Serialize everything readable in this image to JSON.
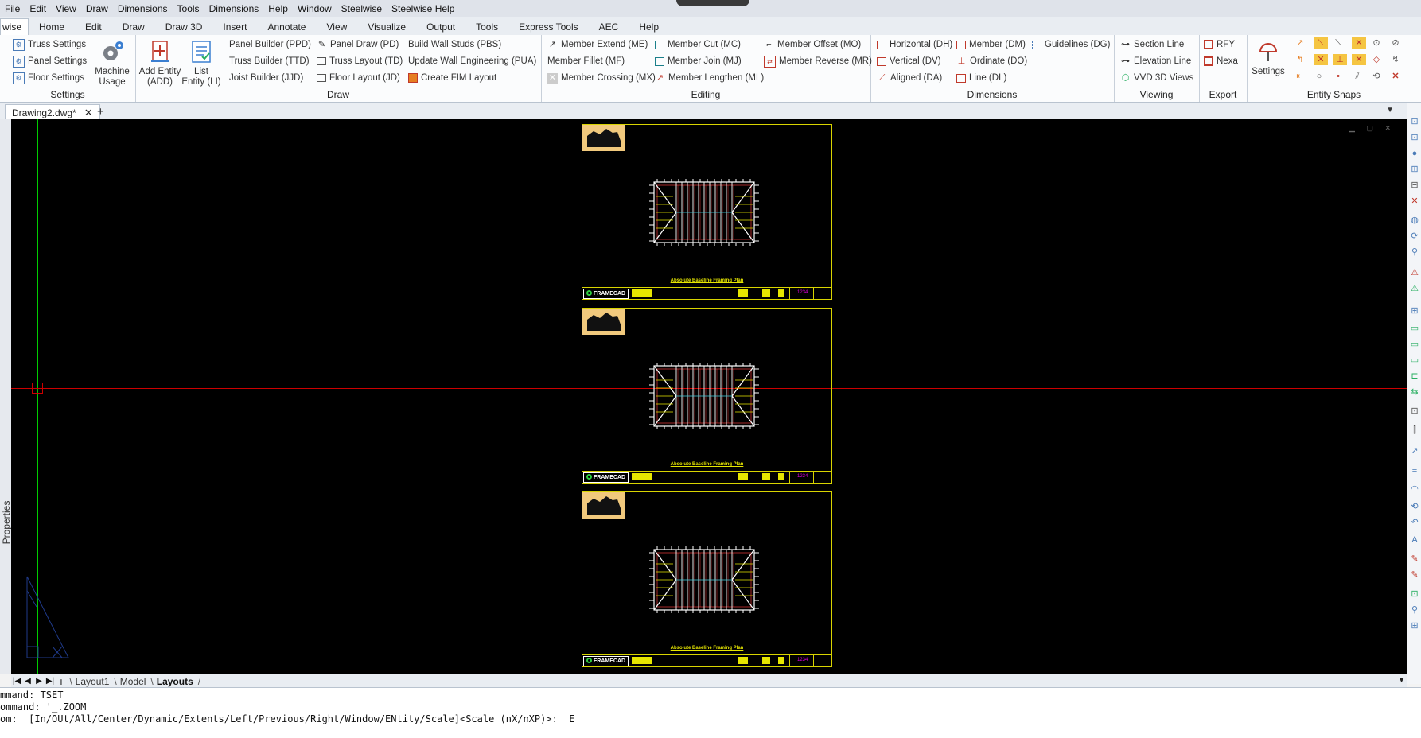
{
  "menu": [
    "File",
    "Edit",
    "View",
    "Draw",
    "Dimensions",
    "Tools",
    "Dimensions",
    "Help",
    "Window",
    "Steelwise",
    "Steelwise Help"
  ],
  "ribbon_tabs": [
    "wise",
    "Home",
    "Edit",
    "Draw",
    "Draw 3D",
    "Insert",
    "Annotate",
    "View",
    "Visualize",
    "Output",
    "Tools",
    "Express Tools",
    "AEC",
    "Help"
  ],
  "ribbon": {
    "settings": {
      "label": "Settings",
      "truss_settings": "Truss Settings",
      "panel_settings": "Panel Settings",
      "floor_settings": "Floor Settings",
      "machine_usage": [
        "Machine",
        "Usage"
      ]
    },
    "draw": {
      "label": "Draw",
      "add_entity": [
        "Add Entity",
        "(ADD)"
      ],
      "list_entity": [
        "List",
        "Entity (LI)"
      ],
      "panel_builder": "Panel Builder (PPD)",
      "truss_builder": "Truss Builder (TTD)",
      "joist_builder": "Joist Builder (JJD)",
      "panel_draw": "Panel Draw (PD)",
      "truss_layout": "Truss Layout (TD)",
      "floor_layout": "Floor Layout (JD)",
      "build_wall_studs": "Build Wall Studs (PBS)",
      "update_wall_engineering": "Update Wall Engineering (PUA)",
      "create_fim_layout": "Create FIM Layout"
    },
    "editing": {
      "label": "Editing",
      "member_extend": "Member Extend (ME)",
      "member_fillet": "Member Fillet (MF)",
      "member_crossing": "Member Crossing (MX)",
      "member_cut": "Member Cut (MC)",
      "member_join": "Member Join (MJ)",
      "member_lengthen": "Member Lengthen (ML)",
      "member_offset": "Member Offset (MO)",
      "member_reverse": "Member Reverse (MR)"
    },
    "dimensions": {
      "label": "Dimensions",
      "horizontal": "Horizontal (DH)",
      "vertical": "Vertical (DV)",
      "aligned": "Aligned (DA)",
      "member": "Member (DM)",
      "ordinate": "Ordinate (DO)",
      "line": "Line (DL)",
      "guidelines": "Guidelines (DG)"
    },
    "viewing": {
      "label": "Viewing",
      "section_line": "Section Line",
      "elevation_line": "Elevation Line",
      "vvd_3d_views": "VVD 3D Views"
    },
    "export": {
      "label": "Export",
      "rfy": "RFY",
      "nexa": "Nexa"
    },
    "entity_snaps": {
      "label": "Entity Snaps",
      "settings": "Settings"
    }
  },
  "document_tab": "Drawing2.dwg*",
  "properties_label": "Properties",
  "sheets": [
    {
      "title": "Absolute Baseline Framing Plan",
      "brand": "FRAMECAD",
      "number": "1234"
    },
    {
      "title": "Absolute Baseline Framing Plan",
      "brand": "FRAMECAD",
      "number": "1234"
    },
    {
      "title": "Absolute Baseline Framing Plan",
      "brand": "FRAMECAD",
      "number": "1234"
    }
  ],
  "layout_tabs": [
    "Layout1",
    "Model",
    "Layouts"
  ],
  "command_lines": [
    "mmand: TSET",
    "ommand: '_.ZOOM",
    "om:  [In/OUt/All/Center/Dynamic/Extents/Left/Previous/Right/Window/ENtity/Scale]<Scale (nX/nXP)>: _E"
  ],
  "colors": {
    "canvas": "#000000",
    "crosshair_h": "#cc0000",
    "crosshair_v": "#00cc00",
    "sheet_border": "#d8d400",
    "logo_fill": "#f1c97d"
  }
}
